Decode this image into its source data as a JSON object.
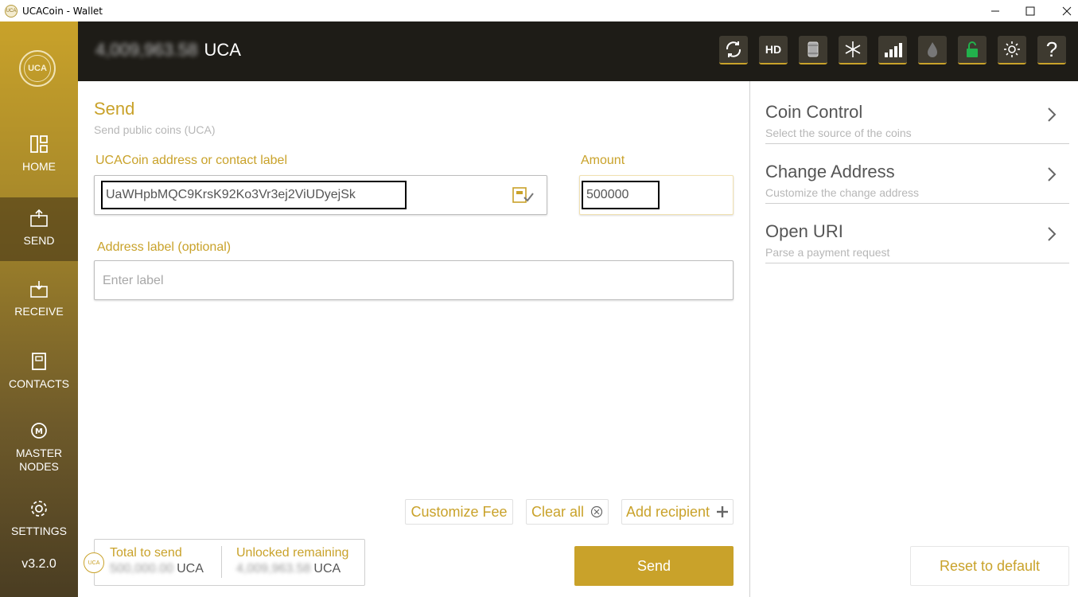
{
  "window": {
    "title": "UCACoin - Wallet"
  },
  "sidebar": {
    "logo_text": "UCA",
    "items": [
      {
        "label": "HOME",
        "icon": "home-icon"
      },
      {
        "label": "SEND",
        "icon": "send-icon"
      },
      {
        "label": "RECEIVE",
        "icon": "receive-icon"
      },
      {
        "label": "CONTACTS",
        "icon": "contacts-icon"
      },
      {
        "label": "MASTER\nNODES",
        "icon": "masternodes-icon"
      },
      {
        "label": "SETTINGS",
        "icon": "settings-icon"
      }
    ],
    "version": "v3.2.0"
  },
  "topbar": {
    "balance_value": "4,009,963.58",
    "balance_unit": "UCA",
    "hd_label": "HD",
    "help_label": "?"
  },
  "send": {
    "title": "Send",
    "subtitle": "Send public coins (UCA)",
    "address_label": "UCACoin address or contact label",
    "address_value": "UaWHpbMQC9KrsK92Ko3Vr3ej2ViUDyejSk",
    "amount_label": "Amount",
    "amount_value": "500000",
    "addr_label_title": "Address label (optional)",
    "addr_label_placeholder": "Enter label",
    "customize_fee": "Customize Fee",
    "clear_all": "Clear all",
    "add_recipient": "Add recipient",
    "total_label": "Total to send",
    "total_value": "500,000.00",
    "total_unit": "UCA",
    "unlocked_label": "Unlocked remaining",
    "unlocked_value": "4,009,963.58",
    "unlocked_unit": "UCA",
    "send_button": "Send"
  },
  "options": {
    "coin_control_title": "Coin Control",
    "coin_control_sub": "Select the source of the coins",
    "change_address_title": "Change Address",
    "change_address_sub": "Customize the change address",
    "open_uri_title": "Open URI",
    "open_uri_sub": "Parse a payment request",
    "reset_button": "Reset to default"
  },
  "colors": {
    "accent": "#c9a22a",
    "topbar": "#1e1c17"
  }
}
